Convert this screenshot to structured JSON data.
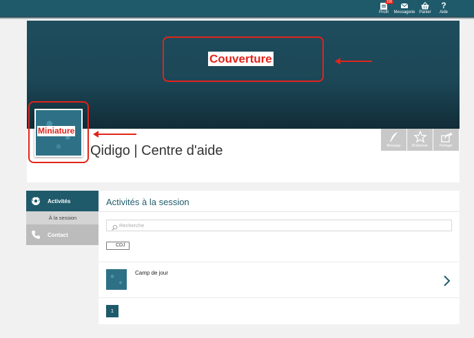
{
  "topnav": [
    {
      "id": "profil",
      "label": "Profil",
      "icon": "profile-card-icon",
      "badge": "100"
    },
    {
      "id": "messagerie",
      "label": "Messagerie",
      "icon": "envelope-icon"
    },
    {
      "id": "panier",
      "label": "Panier",
      "icon": "basket-icon"
    },
    {
      "id": "aide",
      "label": "Aide",
      "icon": "question-icon"
    }
  ],
  "annotations": {
    "cover_label": "Couverture",
    "thumbnail_label": "Miniature"
  },
  "page": {
    "title": "Qidigo | Centre d'aide"
  },
  "actions": [
    {
      "label": "Message",
      "icon": "feather-icon"
    },
    {
      "label": "M'abonner",
      "icon": "star-icon"
    },
    {
      "label": "Partager",
      "icon": "share-icon"
    }
  ],
  "sidebar": {
    "items": [
      {
        "label": "Activités",
        "icon": "soccer-ball-icon",
        "active": true
      },
      {
        "label": "À la session",
        "sub": true
      },
      {
        "label": "Contact",
        "icon": "phone-icon",
        "active": false
      }
    ]
  },
  "main": {
    "title": "Activités à la session",
    "search_placeholder": "Recherche",
    "filter_tag": "CDJ",
    "results": [
      {
        "title": "Camp de jour"
      }
    ],
    "pagination": {
      "current": "1"
    }
  },
  "colors": {
    "brand": "#1f5a6b",
    "annotation": "#e2231a"
  }
}
